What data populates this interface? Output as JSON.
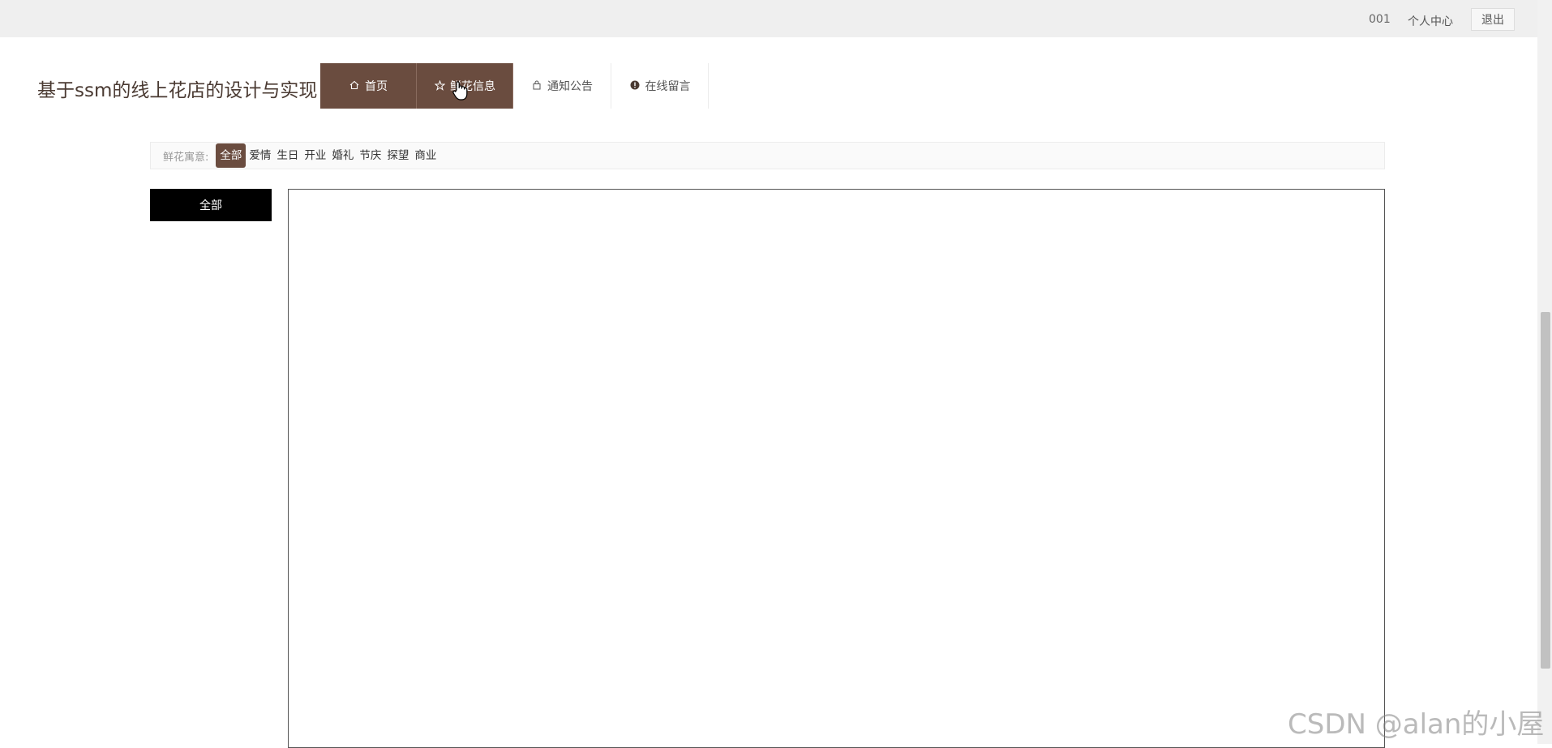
{
  "topbar": {
    "user": "001",
    "personal_center": "个人中心",
    "logout": "退出"
  },
  "site": {
    "title": "基于ssm的线上花店的设计与实现"
  },
  "nav": {
    "items": [
      {
        "label": "首页",
        "icon": "home-icon",
        "active": true
      },
      {
        "label": "鲜花信息",
        "icon": "star-icon",
        "active": true
      },
      {
        "label": "通知公告",
        "icon": "bag-icon",
        "active": false
      },
      {
        "label": "在线留言",
        "icon": "alert-icon",
        "active": false
      }
    ]
  },
  "filter": {
    "label": "鲜花寓意:",
    "chips": [
      "全部",
      "爱情",
      "生日",
      "开业",
      "婚礼",
      "节庆",
      "探望",
      "商业"
    ],
    "selected": "全部"
  },
  "sidebar": {
    "button": "全部"
  },
  "watermark": "CSDN @alan的小屋",
  "colors": {
    "brand": "#6a4c3f",
    "topbar_bg": "#efefef",
    "sidebar_button_bg": "#000000"
  }
}
